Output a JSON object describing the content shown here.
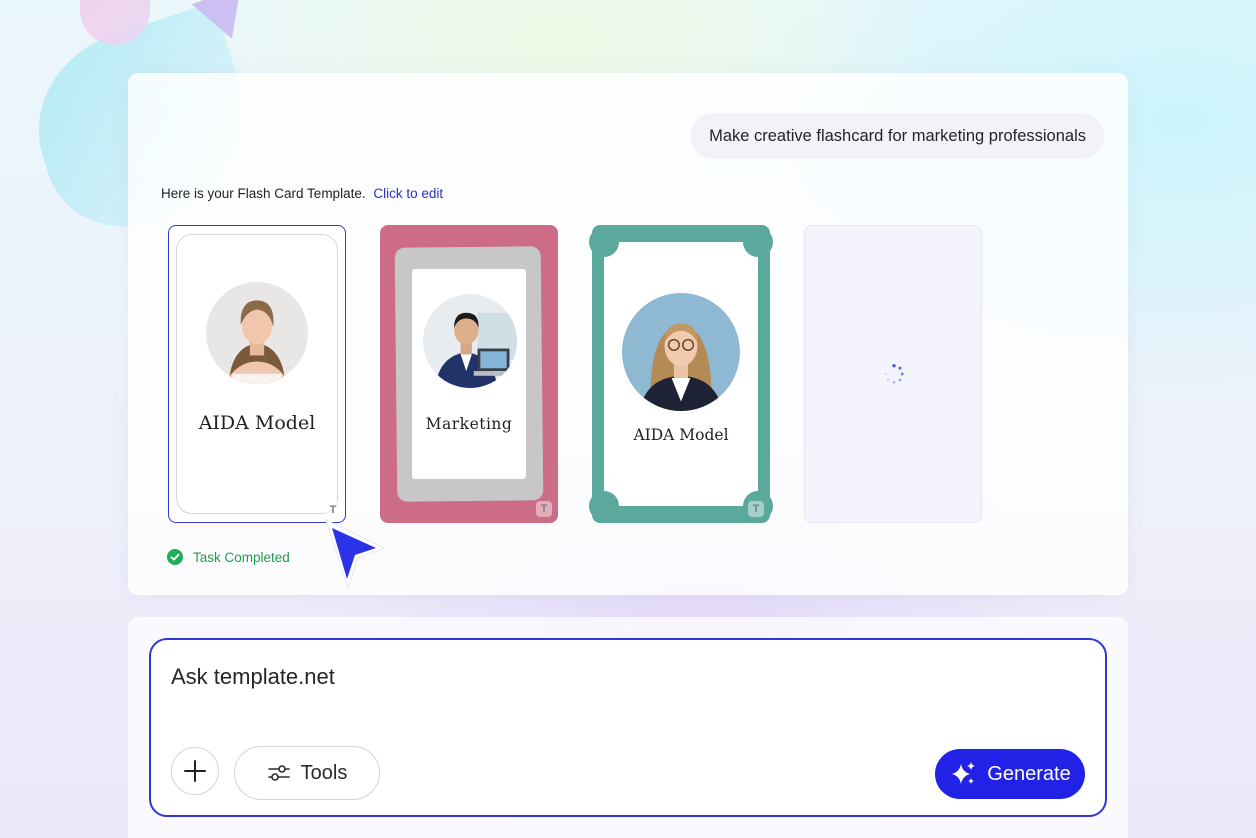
{
  "chat": {
    "user_message": "Make creative flashcard for marketing professionals",
    "reply_text": "Here is your Flash Card Template.",
    "reply_link": "Click to edit",
    "status_text": "Task Completed"
  },
  "cards": [
    {
      "title": "AIDA Model",
      "badge": "T",
      "state": "selected",
      "color": "#ffffff"
    },
    {
      "title": "Marketing",
      "badge": "T",
      "state": "ready",
      "color": "#cc6c86"
    },
    {
      "title": "AIDA Model",
      "badge": "T",
      "state": "ready",
      "color": "#5aa99c"
    },
    {
      "title": "",
      "state": "loading",
      "color": "#f3f4fc"
    }
  ],
  "composer": {
    "placeholder": "Ask template.net",
    "plus_icon": "plus-icon",
    "tools_label": "Tools",
    "tools_icon": "sliders-icon",
    "generate_label": "Generate",
    "generate_icon": "sparkles-icon"
  },
  "colors": {
    "accent": "#2222e6",
    "selection": "#3438d8",
    "link": "#2c2ec9",
    "success": "#1e9c4f"
  }
}
